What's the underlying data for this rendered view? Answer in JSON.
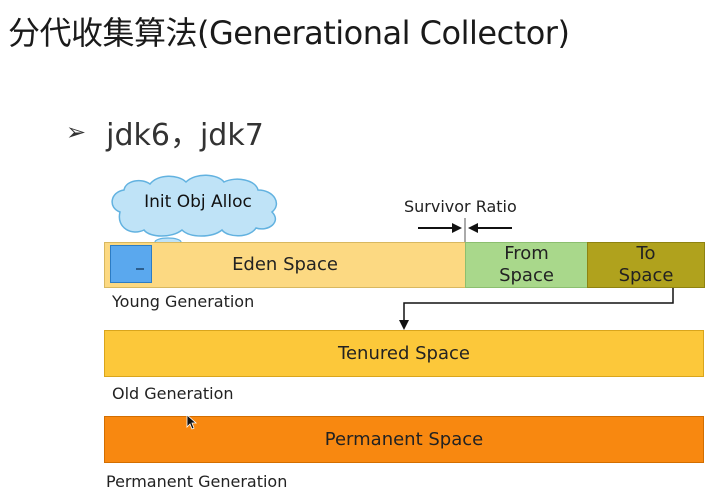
{
  "title": "分代收集算法(Generational Collector)",
  "bullet": {
    "text": "jdk6，jdk7"
  },
  "diagram": {
    "cloud_label": "Init Obj Alloc",
    "survivor_ratio_label": "Survivor Ratio",
    "young": {
      "eden_label": "Eden Space",
      "from_label_line1": "From",
      "from_label_line2": "Space",
      "to_label_line1": "To",
      "to_label_line2": "Space",
      "generation_label": "Young Generation"
    },
    "old": {
      "tenured_label": "Tenured Space",
      "generation_label": "Old Generation"
    },
    "permanent": {
      "permanent_label": "Permanent Space",
      "generation_label": "Permanent Generation"
    },
    "colors": {
      "eden": "#fcd982",
      "from": "#a9d88b",
      "to": "#b0a21d",
      "tenured": "#fcc83a",
      "permanent": "#f88810",
      "cloud": "#bfe3f7"
    }
  }
}
